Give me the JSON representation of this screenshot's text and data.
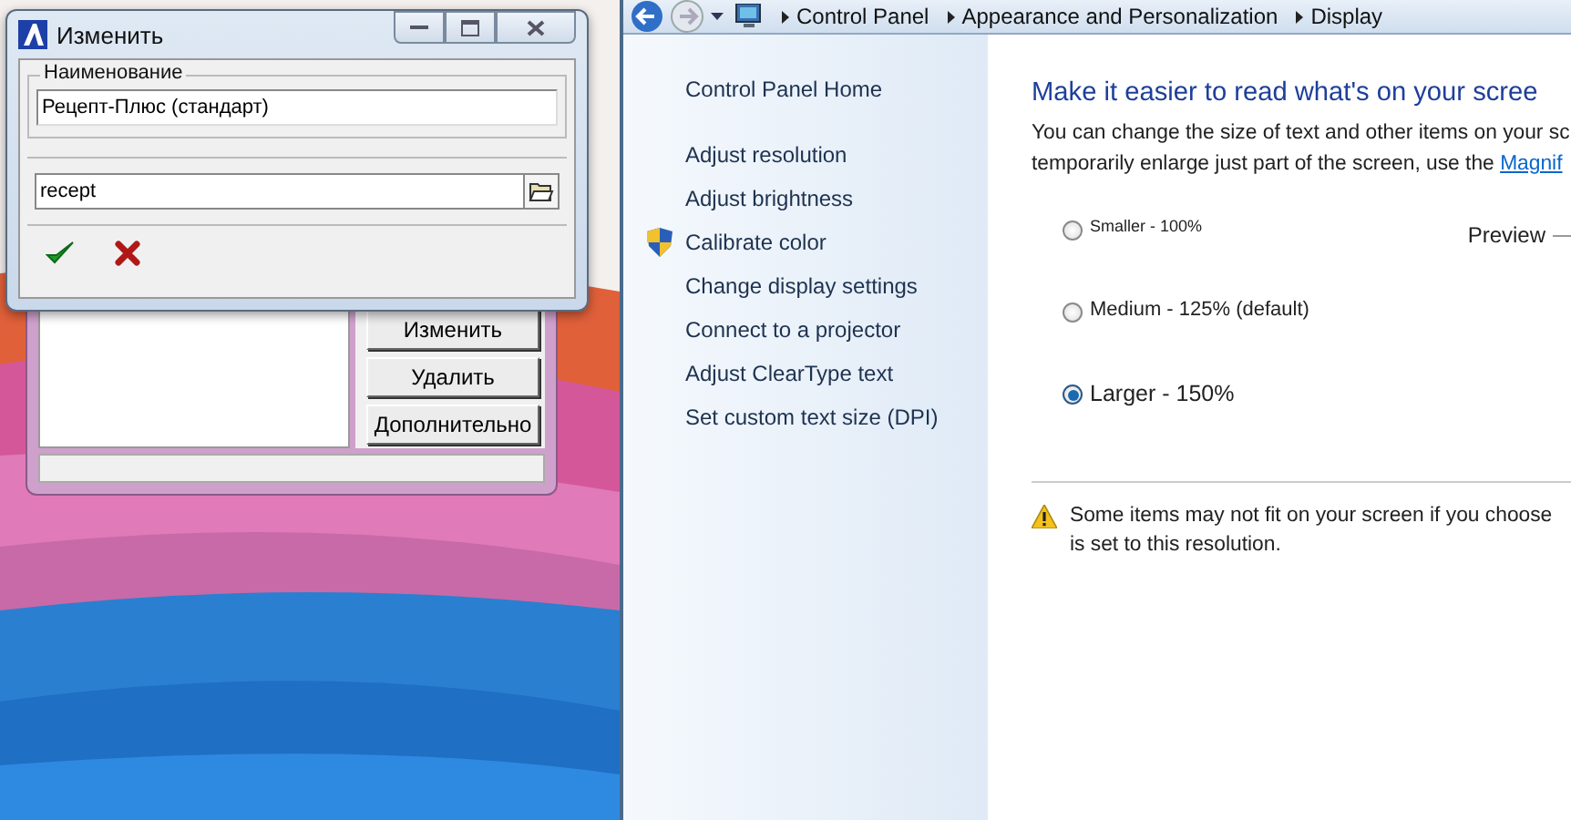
{
  "background_window": {
    "buttons": [
      "Изменить",
      "Удалить",
      "Дополнительно"
    ]
  },
  "dialog": {
    "title": "Изменить",
    "name_group": {
      "label": "Наименование",
      "value": "Рецепт-Плюс (стандарт)"
    },
    "file_field": {
      "value": "recept"
    }
  },
  "control_panel": {
    "breadcrumbs": [
      "Control Panel",
      "Appearance and Personalization",
      "Display"
    ],
    "sidebar": {
      "items": [
        {
          "label": "Control Panel Home",
          "kind": "home"
        },
        {
          "label": "Adjust resolution",
          "kind": "link"
        },
        {
          "label": "Adjust brightness",
          "kind": "link"
        },
        {
          "label": "Calibrate color",
          "kind": "shield"
        },
        {
          "label": "Change display settings",
          "kind": "link"
        },
        {
          "label": "Connect to a projector",
          "kind": "link"
        },
        {
          "label": "Adjust ClearType text",
          "kind": "link"
        },
        {
          "label": "Set custom text size (DPI)",
          "kind": "link"
        }
      ]
    },
    "heading": "Make it easier to read what's on your scree",
    "description_lines": [
      "You can change the size of text and other items on your sc",
      "temporarily enlarge just part of the screen, use the "
    ],
    "magnifier_link": "Magnif",
    "options": [
      {
        "label": "Smaller - 100%",
        "kind": "small",
        "selected": false
      },
      {
        "label": "Medium - 125% (default)",
        "kind": "medium",
        "selected": false
      },
      {
        "label": "Larger - 150%",
        "kind": "large",
        "selected": true
      }
    ],
    "preview_label": "Preview",
    "warning_lines": [
      "Some items may not fit on your screen if you choose",
      "is set to this resolution."
    ]
  }
}
